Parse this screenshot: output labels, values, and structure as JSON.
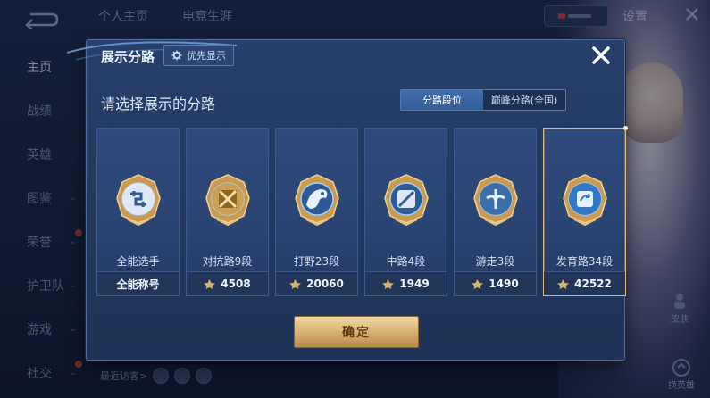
{
  "background": {
    "top_tabs": [
      "个人主页",
      "电竞生涯"
    ],
    "settings_label": "设置",
    "nav": [
      {
        "label": "主页",
        "active": true,
        "chevron": false,
        "dot": false
      },
      {
        "label": "战绩",
        "active": false,
        "chevron": false,
        "dot": false
      },
      {
        "label": "英雄",
        "active": false,
        "chevron": false,
        "dot": false
      },
      {
        "label": "图鉴",
        "active": false,
        "chevron": true,
        "dot": false
      },
      {
        "label": "荣誉",
        "active": false,
        "chevron": true,
        "dot": true
      },
      {
        "label": "护卫队",
        "active": false,
        "chevron": true,
        "dot": false
      },
      {
        "label": "游戏",
        "active": false,
        "chevron": true,
        "dot": false
      },
      {
        "label": "社交",
        "active": false,
        "chevron": true,
        "dot": true
      }
    ],
    "recent_visitors_label": "最近访客>",
    "side_button_label": "皮肤",
    "bottom_button_label": "换英雄"
  },
  "modal": {
    "title": "展示分路",
    "preference_chip": "优先显示",
    "prompt": "请选择展示的分路",
    "tabs": [
      {
        "label": "分路段位",
        "active": true
      },
      {
        "label": "巅峰分路(全国)",
        "active": false
      }
    ],
    "cards": [
      {
        "name": "全能选手",
        "value": "全能称号",
        "show_icon": false,
        "selected": false,
        "badge_icon": "all-round-badge-icon"
      },
      {
        "name": "对抗路9段",
        "value": "4508",
        "show_icon": true,
        "selected": false,
        "badge_icon": "clash-lane-badge-icon"
      },
      {
        "name": "打野23段",
        "value": "20060",
        "show_icon": true,
        "selected": false,
        "badge_icon": "jungle-badge-icon"
      },
      {
        "name": "中路4段",
        "value": "1949",
        "show_icon": true,
        "selected": false,
        "badge_icon": "mid-lane-badge-icon"
      },
      {
        "name": "游走3段",
        "value": "1490",
        "show_icon": true,
        "selected": false,
        "badge_icon": "roam-badge-icon"
      },
      {
        "name": "发育路34段",
        "value": "42522",
        "show_icon": true,
        "selected": true,
        "badge_icon": "farm-lane-badge-icon"
      }
    ],
    "confirm_label": "确定"
  },
  "colors": {
    "accent_gold": "#d8b072",
    "tab_active": "#3f6ead",
    "card_bg": "#2f4b7c"
  }
}
